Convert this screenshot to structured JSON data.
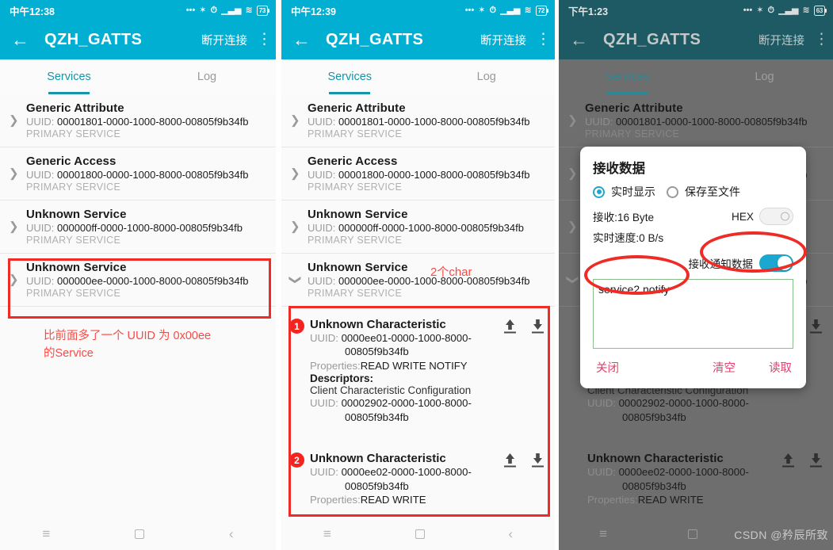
{
  "app": {
    "title": "QZH_GATTS",
    "disconnect_label": "断开连接",
    "back_icon": "←",
    "kebab_icon": "⋮"
  },
  "tabs": {
    "services": "Services",
    "log": "Log"
  },
  "status_bars": [
    {
      "time": "中午12:38",
      "battery": "73"
    },
    {
      "time": "中午12:39",
      "battery": "72"
    },
    {
      "time": "下午1:23",
      "battery": "63"
    }
  ],
  "services": [
    {
      "name": "Generic Attribute",
      "uuid_label": "UUID:",
      "uuid": "00001801-0000-1000-8000-00805f9b34fb",
      "type": "PRIMARY SERVICE"
    },
    {
      "name": "Generic Access",
      "uuid_label": "UUID:",
      "uuid": "00001800-0000-1000-8000-00805f9b34fb",
      "type": "PRIMARY SERVICE"
    },
    {
      "name": "Unknown Service",
      "uuid_label": "UUID:",
      "uuid": "000000ff-0000-1000-8000-00805f9b34fb",
      "type": "PRIMARY SERVICE"
    },
    {
      "name": "Unknown Service",
      "uuid_label": "UUID:",
      "uuid": "000000ee-0000-1000-8000-00805f9b34fb",
      "type": "PRIMARY SERVICE"
    }
  ],
  "characteristics": [
    {
      "badge": "1",
      "name": "Unknown Characteristic",
      "uuid_label": "UUID:",
      "uuid_line1": "0000ee01-0000-1000-8000-",
      "uuid_line2": "00805f9b34fb",
      "properties_label": "Properties:",
      "properties": "READ WRITE NOTIFY",
      "descriptors_label": "Descriptors:",
      "descriptor_name": "Client Characteristic Configuration",
      "descriptor_uuid_label": "UUID:",
      "descriptor_uuid_line1": "00002902-0000-1000-8000-",
      "descriptor_uuid_line2": "00805f9b34fb"
    },
    {
      "badge": "2",
      "name": "Unknown Characteristic",
      "uuid_label": "UUID:",
      "uuid_line1": "0000ee02-0000-1000-8000-",
      "uuid_line2": "00805f9b34fb",
      "properties_label": "Properties:",
      "properties": "READ WRITE"
    }
  ],
  "annotations": {
    "panel1_note_line1": "比前面多了一个 UUID 为 0x00ee",
    "panel1_note_line2": "的Service",
    "panel2_char_count": "2个char",
    "accent_red": "#ee2b26"
  },
  "dialog": {
    "title": "接收数据",
    "radio_realtime": "实时显示",
    "radio_savefile": "保存至文件",
    "received_label": "接收:16 Byte",
    "hex_label": "HEX",
    "speed_label": "实时速度:0 B/s",
    "notify_label": "接收通知数据",
    "data_value": "service2 notify",
    "btn_close": "关闭",
    "btn_clear": "清空",
    "btn_read": "读取"
  },
  "navbar": {
    "menu_icon": "≡",
    "home_icon": "square",
    "back_icon": "‹"
  },
  "watermark": "CSDN @矜辰所致",
  "colors": {
    "teal": "#00AFD1",
    "tab_active": "#1496a8",
    "toggle_on": "#1aa7d0",
    "dialog_action": "#e0436f"
  }
}
